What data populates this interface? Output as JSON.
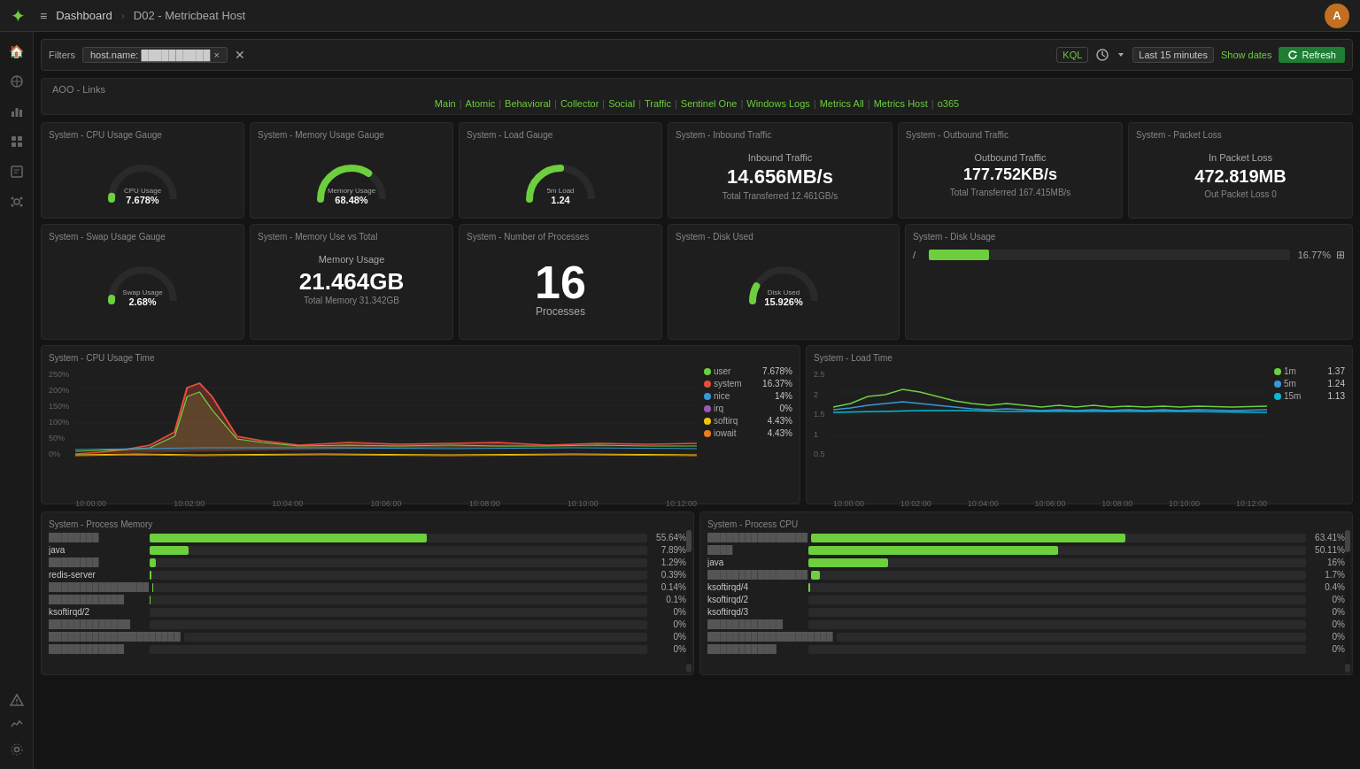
{
  "app": {
    "logo": "✦",
    "menu_icon": "≡",
    "breadcrumb_home": "Dashboard",
    "separator": "›",
    "path": "D02 - Metricbeat Host"
  },
  "topbar": {
    "avatar_initials": "A"
  },
  "filterbar": {
    "label": "Filters",
    "chip": "host.name: ██████████",
    "kql": "KQL",
    "time": "Last 15 minutes",
    "show_dates": "Show dates",
    "refresh": "Refresh"
  },
  "aoo": {
    "title": "AOO - Links",
    "links": [
      "Main",
      "Atomic",
      "Behavioral",
      "Collector",
      "Social",
      "Traffic",
      "Sentinel One",
      "Windows Logs",
      "Metrics All",
      "Metrics Host",
      "o365"
    ]
  },
  "panels": {
    "cpu_gauge": {
      "title": "System - CPU Usage Gauge",
      "label": "CPU Usage",
      "value": "7.678%",
      "percent": 7.678
    },
    "memory_gauge": {
      "title": "System - Memory Usage Gauge",
      "label": "Memory Usage",
      "value": "68.48%",
      "percent": 68.48
    },
    "load_gauge": {
      "title": "System - Load Gauge",
      "label": "5m Load",
      "value": "1.24",
      "percent": 50
    },
    "inbound": {
      "title": "System - Inbound Traffic",
      "label": "Inbound Traffic",
      "value": "14.656MB/s",
      "sub": "Total Transferred 12.461GB/s"
    },
    "outbound": {
      "title": "System - Outbound Traffic",
      "label": "Outbound Traffic",
      "value": "177.752KB/s",
      "sub": "Total Transferred 167.415MB/s"
    },
    "packet_loss": {
      "title": "System - Packet Loss",
      "label": "In Packet Loss",
      "value": "472.819MB",
      "sub": "Out Packet Loss 0"
    },
    "swap_gauge": {
      "title": "System - Swap Usage Gauge",
      "label": "Swap Usage",
      "value": "2.68%",
      "percent": 2.68
    },
    "memory_total": {
      "title": "System - Memory Use vs Total",
      "label": "Memory Usage",
      "value": "21.464GB",
      "sub": "Total Memory 31.342GB"
    },
    "processes_count": {
      "title": "System - Number of Processes",
      "value": "16",
      "sub": "Processes"
    },
    "disk_used": {
      "title": "System - Disk Used",
      "label": "Disk Used",
      "value": "15.926%",
      "percent": 15.926
    },
    "disk_usage": {
      "title": "System - Disk Usage",
      "mount": "/",
      "percent": 16.77,
      "label": "16.77%"
    },
    "cpu_time": {
      "title": "System - CPU Usage Time",
      "legend": [
        {
          "name": "user",
          "value": "7.678%",
          "color": "#6dcf3e"
        },
        {
          "name": "system",
          "value": "16.37%",
          "color": "#e74c3c"
        },
        {
          "name": "nice",
          "value": "14%",
          "color": "#3498db"
        },
        {
          "name": "irq",
          "value": "0%",
          "color": "#9b59b6"
        },
        {
          "name": "softirq",
          "value": "4.43%",
          "color": "#f1c40f"
        },
        {
          "name": "iowait",
          "value": "4.43%",
          "color": "#e67e22"
        }
      ],
      "x_labels": [
        "10:00:00",
        "10:02:00",
        "10:04:00",
        "10:06:00",
        "10:08:00",
        "10:10:00",
        "10:12:00"
      ],
      "y_labels": [
        "250%",
        "200%",
        "150%",
        "100%",
        "50%",
        "0%"
      ],
      "per": "per 10 seconds"
    },
    "load_time": {
      "title": "System - Load Time",
      "legend": [
        {
          "name": "1m",
          "value": "1.37",
          "color": "#6dcf3e"
        },
        {
          "name": "5m",
          "value": "1.24",
          "color": "#3498db"
        },
        {
          "name": "15m",
          "value": "1.13",
          "color": "#00bcd4"
        }
      ],
      "x_labels": [
        "10:00:00",
        "10:02:00",
        "10:04:00",
        "10:06:00",
        "10:08:00",
        "10:10:00",
        "10:12:00"
      ],
      "y_labels": [
        "2.5",
        "2",
        "1.5",
        "1",
        "0.5"
      ],
      "per": "per 10 seconds"
    },
    "process_memory": {
      "title": "System - Process Memory",
      "rows": [
        {
          "name": "████████",
          "bar": 55.64,
          "pct": "55.64%"
        },
        {
          "name": "java",
          "bar": 7.89,
          "pct": "7.89%"
        },
        {
          "name": "████████",
          "bar": 1.29,
          "pct": "1.29%"
        },
        {
          "name": "redis-server",
          "bar": 0.39,
          "pct": "0.39%"
        },
        {
          "name": "████████████████",
          "bar": 0.14,
          "pct": "0.14%"
        },
        {
          "name": "████████████",
          "bar": 0.1,
          "pct": "0.1%"
        },
        {
          "name": "ksoftirqd/2",
          "bar": 0,
          "pct": "0%"
        },
        {
          "name": "█████████████",
          "bar": 0,
          "pct": "0%"
        },
        {
          "name": "█████████████████████",
          "bar": 0,
          "pct": "0%"
        },
        {
          "name": "████████████",
          "bar": 0,
          "pct": "0%"
        }
      ]
    },
    "process_cpu": {
      "title": "System - Process CPU",
      "rows": [
        {
          "name": "████████████████",
          "bar": 63.41,
          "pct": "63.41%"
        },
        {
          "name": "████",
          "bar": 50.11,
          "pct": "50.11%"
        },
        {
          "name": "java",
          "bar": 16,
          "pct": "16%"
        },
        {
          "name": "████████████████",
          "bar": 1.7,
          "pct": "1.7%"
        },
        {
          "name": "ksoftirqd/4",
          "bar": 0.4,
          "pct": "0.4%"
        },
        {
          "name": "ksoftirqd/2",
          "bar": 0,
          "pct": "0%"
        },
        {
          "name": "ksoftirqd/3",
          "bar": 0,
          "pct": "0%"
        },
        {
          "name": "████████████",
          "bar": 0,
          "pct": "0%"
        },
        {
          "name": "████████████████████",
          "bar": 0,
          "pct": "0%"
        },
        {
          "name": "███████████",
          "bar": 0,
          "pct": "0%"
        }
      ]
    }
  },
  "sidebar": {
    "icons": [
      "🏠",
      "📊",
      "🔍",
      "📋",
      "🔔",
      "👤",
      "⚙",
      "⏱",
      "❤",
      "⚙"
    ]
  }
}
